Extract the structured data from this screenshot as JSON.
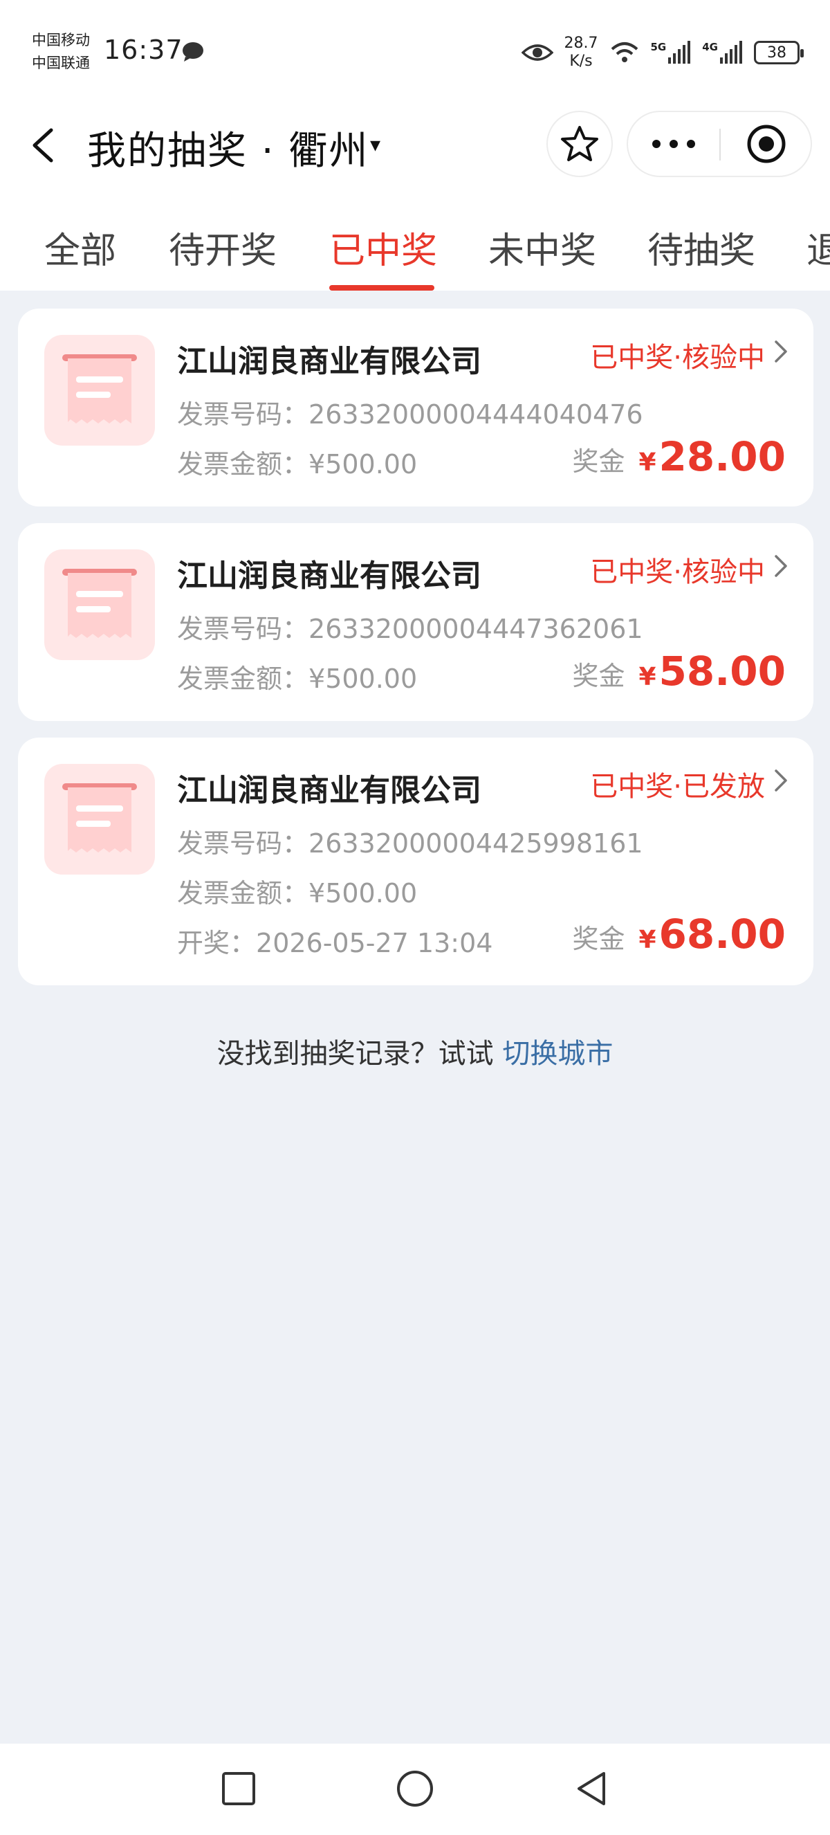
{
  "status_bar": {
    "carrier1": "中国移动",
    "carrier2": "中国联通",
    "time": "16:37",
    "speed_value": "28.7",
    "speed_unit": "K/s",
    "net1": "5G",
    "net2": "4G",
    "battery": "38"
  },
  "nav": {
    "title": "我的抽奖 · 衢州",
    "caret": "▾"
  },
  "tabs": [
    {
      "label": "全部",
      "active": false
    },
    {
      "label": "待开奖",
      "active": false
    },
    {
      "label": "已中奖",
      "active": true
    },
    {
      "label": "未中奖",
      "active": false
    },
    {
      "label": "待抽奖",
      "active": false
    },
    {
      "label": "退",
      "active": false
    }
  ],
  "records": [
    {
      "company": "江山润良商业有限公司",
      "status": "已中奖·核验中",
      "invoice_no_label": "发票号码：",
      "invoice_no": "26332000004444040476",
      "amount_label": "发票金额：",
      "amount": "¥500.00",
      "prize_label": "奖金",
      "prize_currency": "¥",
      "prize_amount": "28.00"
    },
    {
      "company": "江山润良商业有限公司",
      "status": "已中奖·核验中",
      "invoice_no_label": "发票号码：",
      "invoice_no": "26332000004447362061",
      "amount_label": "发票金额：",
      "amount": "¥500.00",
      "prize_label": "奖金",
      "prize_currency": "¥",
      "prize_amount": "58.00"
    },
    {
      "company": "江山润良商业有限公司",
      "status": "已中奖·已发放",
      "invoice_no_label": "发票号码：",
      "invoice_no": "26332000004425998161",
      "amount_label": "发票金额：",
      "amount": "¥500.00",
      "draw_label": "开奖：",
      "draw_time": "2026-05-27 13:04",
      "prize_label": "奖金",
      "prize_currency": "¥",
      "prize_amount": "68.00"
    }
  ],
  "hint": {
    "text": "没找到抽奖记录？试试 ",
    "link": "切换城市"
  },
  "colors": {
    "accent": "#e8382b",
    "link": "#3a6ea5",
    "background": "#eef1f6"
  },
  "icons": [
    "back-icon",
    "star-icon",
    "more-icon",
    "target-icon",
    "receipt-icon",
    "chevron-right-icon",
    "square-icon",
    "circle-icon",
    "triangle-back-icon"
  ]
}
